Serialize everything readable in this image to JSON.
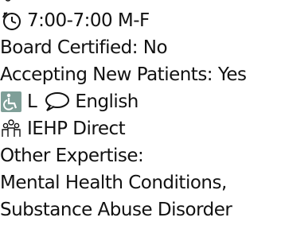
{
  "provider": {
    "hours": {
      "icon": "clock-icon",
      "text": "7:00-7:00 M-F"
    },
    "board_certified": "Board Certified: No",
    "accepting_new_patients": "Accepting New Patients: Yes",
    "accessibility": {
      "icon": "wheelchair-icon",
      "icon_color": "#7f9f98",
      "code": "L",
      "language_icon": "speech-bubble-icon",
      "language": "English"
    },
    "network": {
      "icon": "group-icon",
      "text": "IEHP Direct"
    },
    "other_expertise_label": "Other Expertise:",
    "expertise_lines": [
      "Mental Health Conditions,",
      "Substance Abuse Disorder"
    ]
  }
}
